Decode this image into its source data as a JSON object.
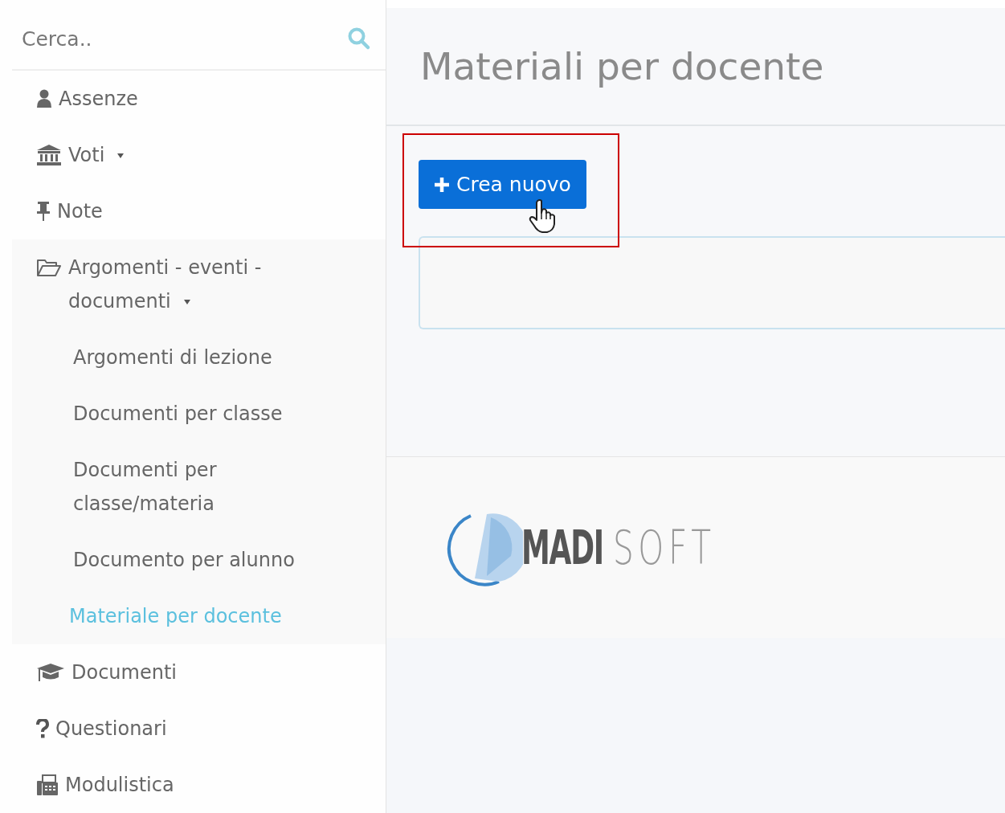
{
  "search": {
    "placeholder": "Cerca.."
  },
  "menu": [
    {
      "kind": "link",
      "label": "Assenze"
    },
    {
      "kind": "dropdown",
      "label": "Voti"
    },
    {
      "kind": "link",
      "label": "Note"
    },
    {
      "kind": "dropdown",
      "label": "Argomenti - eventi - documenti",
      "children": [
        {
          "label": "Argomenti di lezione",
          "selected": false
        },
        {
          "label": "Documenti per classe",
          "selected": false
        },
        {
          "label": "Documenti per classe/materia",
          "selected": false
        },
        {
          "label": "Documento per alunno",
          "selected": false
        },
        {
          "label": "Materiale per docente",
          "selected": true
        }
      ]
    },
    {
      "kind": "link",
      "label": "Documenti"
    },
    {
      "kind": "link",
      "label": "Questionari"
    },
    {
      "kind": "link",
      "label": "Modulistica"
    }
  ],
  "page": {
    "title": "Materiali per docente",
    "create_button": "Crea nuovo"
  },
  "logo": {
    "bold": "MADI",
    "light": "SOFT"
  }
}
